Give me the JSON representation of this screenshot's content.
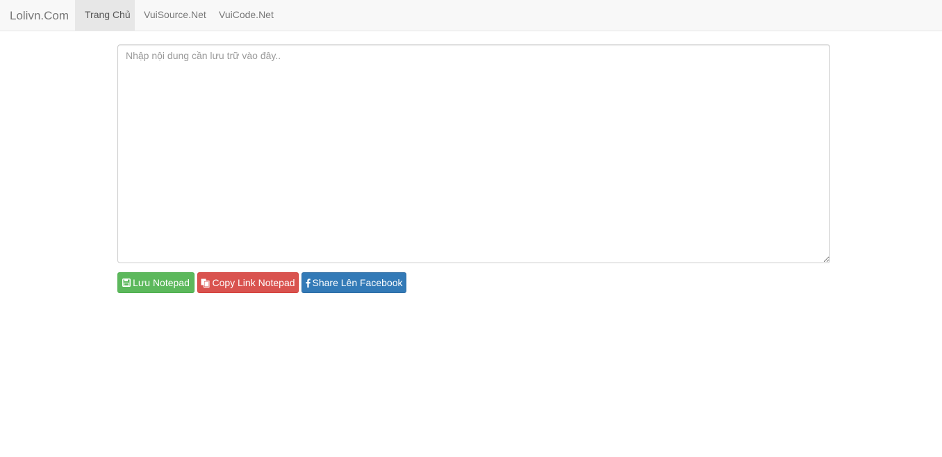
{
  "navbar": {
    "brand": "Lolivn.Com",
    "items": [
      {
        "label": "Trang Chủ",
        "active": true
      },
      {
        "label": "VuiSource.Net",
        "active": false
      },
      {
        "label": "VuiCode.Net",
        "active": false
      }
    ]
  },
  "editor": {
    "value": "",
    "placeholder": "Nhập nội dung cần lưu trữ vào đây.."
  },
  "buttons": {
    "save": {
      "label": "Lưu Notepad",
      "icon": "floppy-disk-icon",
      "color": "#5cb85c"
    },
    "copy": {
      "label": "Copy Link Notepad",
      "icon": "copy-icon",
      "color": "#d9534f"
    },
    "share": {
      "label": "Share Lên Facebook",
      "icon": "facebook-icon",
      "color": "#337ab7"
    }
  }
}
